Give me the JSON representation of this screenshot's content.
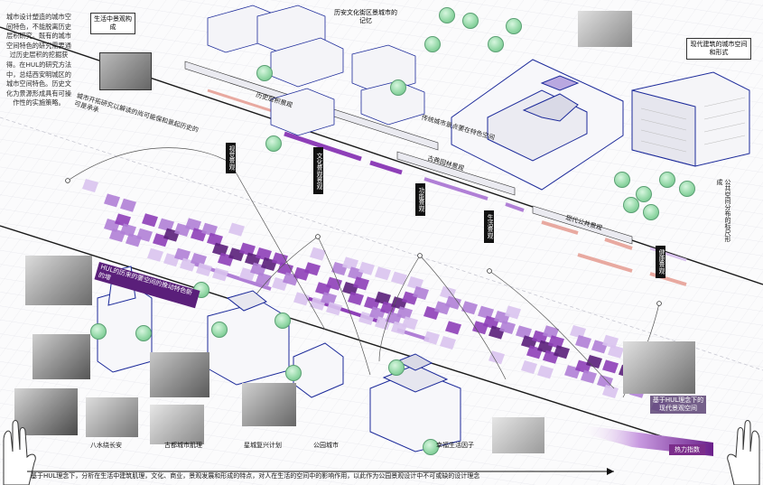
{
  "intro": "城市设计塑造的城市空间特色，不能脱离历史层积研究。既有的城市空间特色的研究需要通过历史层积的挖掘获得。在HUL的研究方法中，总结西安明城区的城市空间特色。历史文化为景源形成具有可操作性的实施策略。",
  "top_labels": {
    "life_landscape": "生活中景观构成",
    "historic_block": "历安文化街区景城市的记忆",
    "modern_arch": "现代建筑的城市空间和形式"
  },
  "diagonal_text": {
    "hul_reading": "城市开拓研究以解读的尚可能保和景起历史的可是承承",
    "heritage_ancient": "传统城市景点要在特色空间",
    "hul_renew": "HUL的历来的要空间的推动特色新的增"
  },
  "layer_labels": {
    "historic": "历史层积景观",
    "ancient_land": "古典园林景观",
    "modern_public": "现代公共景观"
  },
  "column_labels": {
    "visual": "视觉景观",
    "cultural": "文化景观景观",
    "functional": "功能景观",
    "life": "生活景观",
    "health": "健康景观"
  },
  "right_block": "公共空间分布的标尺形成",
  "bottom_right_photo_caption": "基于HUL理念下的现代景观空间",
  "captions": {
    "a": "八水绕长安",
    "b": "古都城市肌理",
    "c": "星城复兴计划",
    "d": "公园城市",
    "e": "幸福生活因子"
  },
  "legend_label": "热力指数",
  "footer": "基于HUL理念下，分析在生活中建筑肌理，文化、商业，景观发展和形成的特点，对人在生活的空间中的影响作用，以此作为公园景观设计中不可或缺的设计理念",
  "colors": {
    "purple_dark": "#5a1f7a",
    "purple": "#8e3fb8",
    "purple_mid": "#b07fd6",
    "purple_light": "#d9c3ee",
    "salmon": "#e8a9a0",
    "building_outline": "#1c2a9a",
    "tree_green": "#9fe0b0"
  },
  "icons": [
    "hand-icon-left",
    "hand-icon-right",
    "tree-icon",
    "pagoda-icon",
    "building-icon"
  ]
}
